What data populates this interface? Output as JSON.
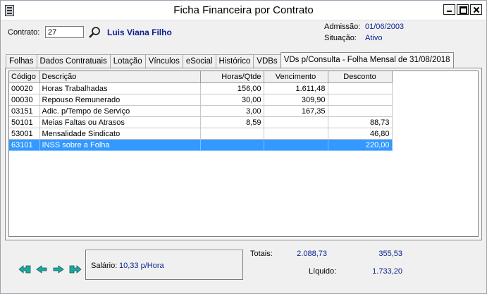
{
  "window": {
    "title": "Ficha Financeira por Contrato"
  },
  "header": {
    "contrato_label": "Contrato:",
    "contrato_value": "27",
    "person_name": "Luis Viana Filho",
    "admissao_label": "Admissão:",
    "admissao_value": "01/06/2003",
    "situacao_label": "Situação:",
    "situacao_value": "Ativo"
  },
  "tabs": [
    {
      "label": "Folhas"
    },
    {
      "label": "Dados Contratuais"
    },
    {
      "label": "Lotação"
    },
    {
      "label": "Vínculos"
    },
    {
      "label": "eSocial"
    },
    {
      "label": "Histórico"
    },
    {
      "label": "VDBs"
    },
    {
      "label": "VDs p/Consulta - Folha Mensal de 31/08/2018"
    }
  ],
  "table": {
    "headers": [
      "Código",
      "Descrição",
      "Horas/Qtde",
      "Vencimento",
      "Desconto"
    ],
    "rows": [
      {
        "codigo": "00020",
        "descricao": "Horas Trabalhadas",
        "horas": "156,00",
        "vencimento": "1.611,48",
        "desconto": ""
      },
      {
        "codigo": "00030",
        "descricao": "Repouso Remunerado",
        "horas": "30,00",
        "vencimento": "309,90",
        "desconto": ""
      },
      {
        "codigo": "03151",
        "descricao": "Adic. p/Tempo de Serviço",
        "horas": "3,00",
        "vencimento": "167,35",
        "desconto": ""
      },
      {
        "codigo": "50101",
        "descricao": "Meias Faltas ou Atrasos",
        "horas": "8,59",
        "vencimento": "",
        "desconto": "88,73"
      },
      {
        "codigo": "53001",
        "descricao": "Mensalidade Sindicato",
        "horas": "",
        "vencimento": "",
        "desconto": "46,80"
      },
      {
        "codigo": "63101",
        "descricao": "INSS sobre a Folha",
        "horas": "",
        "vencimento": "",
        "desconto": "220,00"
      }
    ]
  },
  "footer": {
    "salario_label": "Salário:",
    "salario_value": "10,33 p/Hora",
    "totais_label": "Totais:",
    "total_vencimento": "2.088,73",
    "total_desconto": "355,53",
    "liquido_label": "Líquido:",
    "liquido_value": "1.733,20"
  },
  "colors": {
    "selection": "#3399ff",
    "value_text": "#0a1f8f",
    "arrow_green": "#1fa8a0"
  }
}
